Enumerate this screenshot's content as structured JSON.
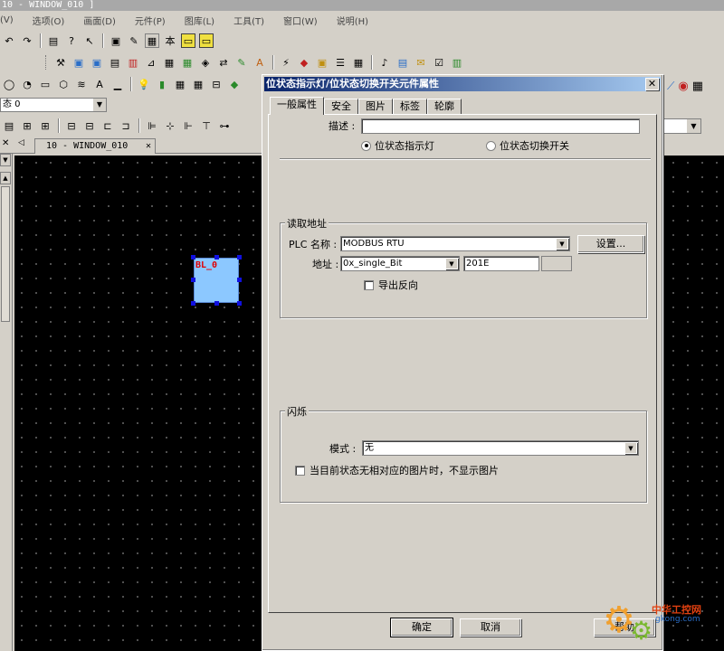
{
  "window": {
    "title": "10 - WINDOW_010 ]"
  },
  "menu": [
    "(V)",
    "选项(O)",
    "画面(D)",
    "元件(P)",
    "图库(L)",
    "工具(T)",
    "窗口(W)",
    "说明(H)"
  ],
  "left_combo": {
    "value": "态 0"
  },
  "document_tab": {
    "label": "10 - WINDOW_010",
    "close": "✕"
  },
  "canvas": {
    "shape_label": "BL_0"
  },
  "dialog": {
    "title": "位状态指示灯/位状态切换开关元件属性",
    "close": "✕",
    "tabs": [
      "一般属性",
      "安全",
      "图片",
      "标签",
      "轮廓"
    ],
    "description_label": "描述 :",
    "description_value": "",
    "radio_indicator": "位状态指示灯",
    "radio_switch": "位状态切换开关",
    "read_group": {
      "title": "读取地址",
      "plc_label": "PLC 名称 :",
      "plc_value": "MODBUS RTU",
      "settings_button": "设置...",
      "address_label": "地址 :",
      "address_type": "0x_single_Bit",
      "address_value": "201E",
      "invert_label": "导出反向"
    },
    "blink_group": {
      "title": "闪烁",
      "mode_label": "模式 :",
      "mode_value": "无",
      "no_image_label": "当目前状态无相对应的图片时，不显示图片"
    },
    "ok_button": "确定",
    "cancel_button": "取消",
    "help_button": "帮助"
  },
  "watermark": {
    "text1": "中华工控网",
    "text2": "gkong.com"
  }
}
